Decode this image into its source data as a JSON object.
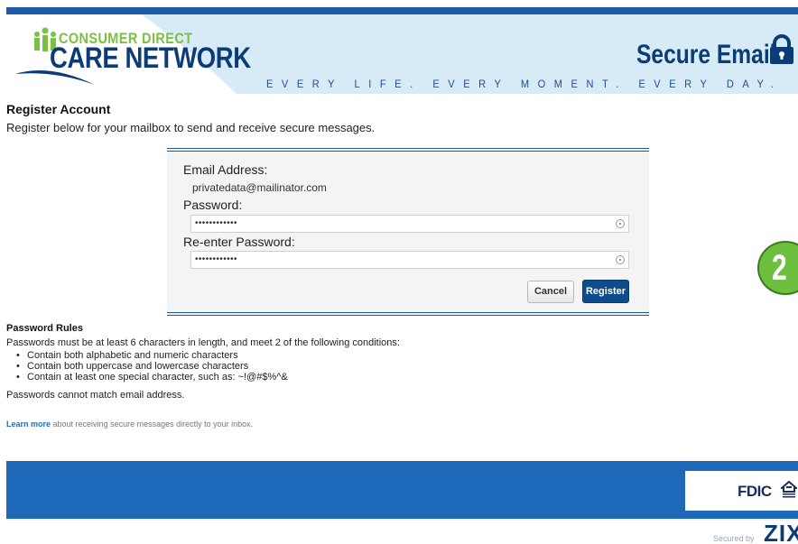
{
  "header": {
    "logo_line1": "CONSUMER DIRECT",
    "logo_line2": "CARE NETWORK",
    "tagline": "EVERY LIFE. EVERY MOMENT. EVERY DAY.",
    "secure_title": "Secure Email",
    "brand_color": "#0c3c78",
    "accent_color": "#7ac143"
  },
  "page": {
    "title": "Register Account",
    "subtitle": "Register below for your mailbox to send and receive secure messages."
  },
  "form": {
    "email_label": "Email Address:",
    "email_value": "privatedata@mailinator.com",
    "password_label": "Password:",
    "password_value": "••••••••••••",
    "reenter_label": "Re-enter Password:",
    "reenter_value": "••••••••••••",
    "cancel_label": "Cancel",
    "register_label": "Register"
  },
  "badge": {
    "number": "2",
    "color": "#6dbf3f"
  },
  "rules": {
    "title": "Password Rules",
    "intro": "Passwords must be at least 6 characters in length, and meet 2 of the following conditions:",
    "items": [
      "Contain both alphabetic and numeric characters",
      "Contain both uppercase and lowercase characters",
      "Contain at least one special character, such as: ~!@#$%^&"
    ],
    "note": "Passwords cannot match email address."
  },
  "learn": {
    "link_text": "Learn more",
    "rest_text": " about receiving secure messages directly to your inbox."
  },
  "footer": {
    "fdic": "FDIC",
    "secured_by": "Secured by",
    "zix": "ZIX",
    "footer_color": "#1d68b8"
  }
}
